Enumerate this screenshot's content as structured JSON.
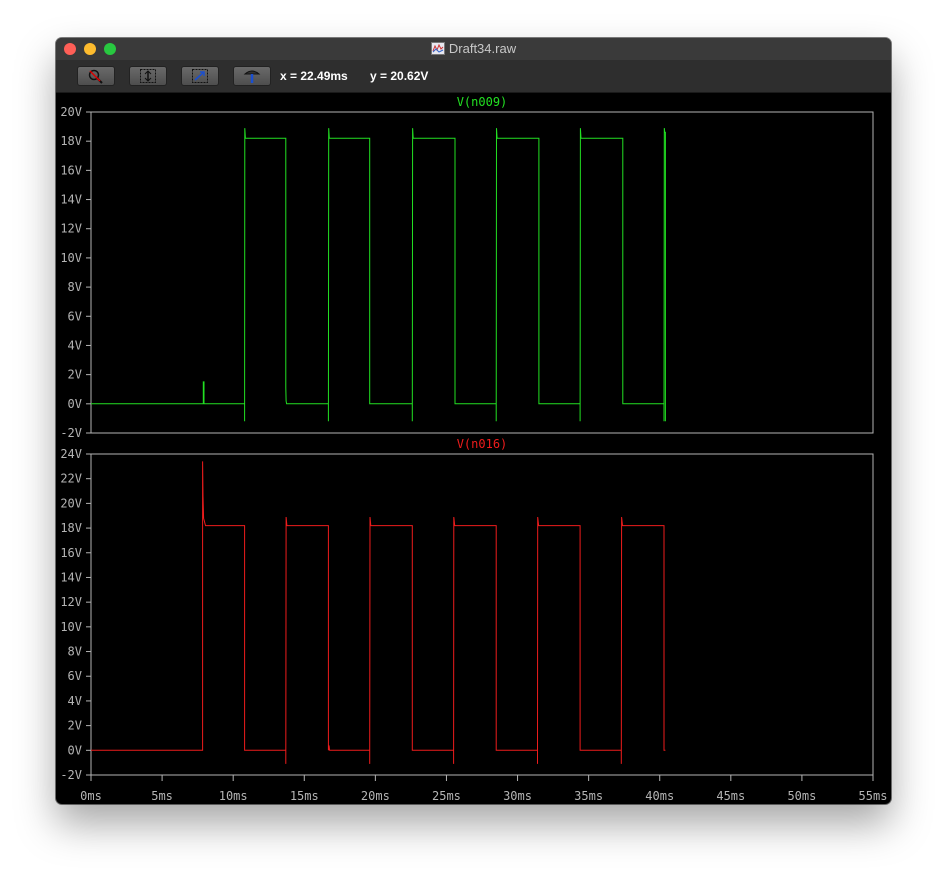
{
  "window": {
    "title": "Draft34.raw"
  },
  "toolbar": {
    "buttons": [
      {
        "icon": "zoom-cancel-icon"
      },
      {
        "icon": "autorange-icon"
      },
      {
        "icon": "pan-icon"
      },
      {
        "icon": "probe-icon"
      }
    ],
    "cursor_x": "x = 22.49ms",
    "cursor_y": "y = 20.62V"
  },
  "colors": {
    "background": "#000000",
    "axis": "#b4b4b4",
    "n009": "#22e022",
    "n016": "#ee1c1c"
  },
  "chart_data": [
    {
      "type": "line",
      "title": "V(n009)",
      "xlim": [
        0,
        55
      ],
      "ylim": [
        -2,
        20
      ],
      "yticks": [
        -2,
        0,
        2,
        4,
        6,
        8,
        10,
        12,
        14,
        16,
        18,
        20
      ],
      "ytick_labels": [
        "-2V",
        "0V",
        "2V",
        "4V",
        "6V",
        "8V",
        "10V",
        "12V",
        "14V",
        "16V",
        "18V",
        "20V"
      ],
      "grid": false,
      "series": [
        {
          "name": "V(n009)",
          "color": "#22e022",
          "x": [
            0,
            7.9,
            7.9,
            7.95,
            7.95,
            10.8,
            10.8,
            10.82,
            10.86,
            11.0,
            11.3,
            13.7,
            13.7,
            13.72,
            13.76,
            13.9,
            16.7,
            16.7,
            16.72,
            16.76,
            16.9,
            17.2,
            19.6,
            19.6,
            22.6,
            22.6,
            22.62,
            22.66,
            22.8,
            23.1,
            25.6,
            25.6,
            28.5,
            28.5,
            28.52,
            28.56,
            28.7,
            29.0,
            31.5,
            31.5,
            34.4,
            34.4,
            34.42,
            34.46,
            34.6,
            34.9,
            37.4,
            37.4,
            40.3,
            40.3,
            40.32,
            40.36,
            40.4,
            40.4
          ],
          "y": [
            0,
            0,
            1.5,
            1.5,
            0,
            0,
            -1.2,
            18.9,
            18.2,
            18.2,
            18.2,
            18.2,
            1.1,
            0.2,
            0,
            0,
            0,
            -1.2,
            18.9,
            18.2,
            18.2,
            18.2,
            18.2,
            0,
            0,
            -1.2,
            18.9,
            18.2,
            18.2,
            18.2,
            18.2,
            0,
            0,
            -1.2,
            18.9,
            18.2,
            18.2,
            18.2,
            18.2,
            0,
            0,
            -1.2,
            18.9,
            18.2,
            18.2,
            18.2,
            18.2,
            0,
            0,
            -1.2,
            18.9,
            18.6,
            18.6,
            -1.2
          ]
        }
      ]
    },
    {
      "type": "line",
      "title": "V(n016)",
      "xlim": [
        0,
        55
      ],
      "ylim": [
        -2,
        24
      ],
      "yticks": [
        -2,
        0,
        2,
        4,
        6,
        8,
        10,
        12,
        14,
        16,
        18,
        20,
        22,
        24
      ],
      "ytick_labels": [
        "-2V",
        "0V",
        "2V",
        "4V",
        "6V",
        "8V",
        "10V",
        "12V",
        "14V",
        "16V",
        "18V",
        "20V",
        "22V",
        "24V"
      ],
      "xticks": [
        0,
        5,
        10,
        15,
        20,
        25,
        30,
        35,
        40,
        45,
        50,
        55
      ],
      "xtick_labels": [
        "0ms",
        "5ms",
        "10ms",
        "15ms",
        "20ms",
        "25ms",
        "30ms",
        "35ms",
        "40ms",
        "45ms",
        "50ms",
        "55ms"
      ],
      "grid": false,
      "series": [
        {
          "name": "V(n016)",
          "color": "#ee1c1c",
          "x": [
            0,
            7.85,
            7.85,
            7.88,
            7.92,
            8.05,
            8.3,
            10.8,
            10.8,
            13.7,
            13.7,
            13.72,
            13.78,
            14.0,
            16.7,
            16.7,
            16.74,
            16.78,
            19.6,
            19.6,
            19.62,
            19.68,
            19.9,
            22.6,
            22.6,
            25.5,
            25.5,
            25.52,
            25.58,
            25.8,
            28.5,
            28.5,
            31.4,
            31.4,
            31.42,
            31.48,
            31.7,
            34.4,
            34.4,
            37.3,
            37.3,
            37.32,
            37.38,
            37.6,
            40.3,
            40.3,
            40.4
          ],
          "y": [
            0,
            0,
            23.4,
            20.6,
            18.8,
            18.2,
            18.2,
            18.2,
            0,
            0,
            -1.1,
            18.9,
            18.2,
            18.2,
            18.2,
            0,
            0.4,
            0,
            0,
            -1.1,
            18.9,
            18.2,
            18.2,
            18.2,
            0,
            0,
            -1.1,
            18.9,
            18.2,
            18.2,
            18.2,
            0,
            0,
            -1.1,
            18.9,
            18.2,
            18.2,
            18.2,
            0,
            0,
            -1.1,
            18.9,
            18.2,
            18.2,
            18.2,
            0,
            0
          ]
        }
      ]
    }
  ]
}
